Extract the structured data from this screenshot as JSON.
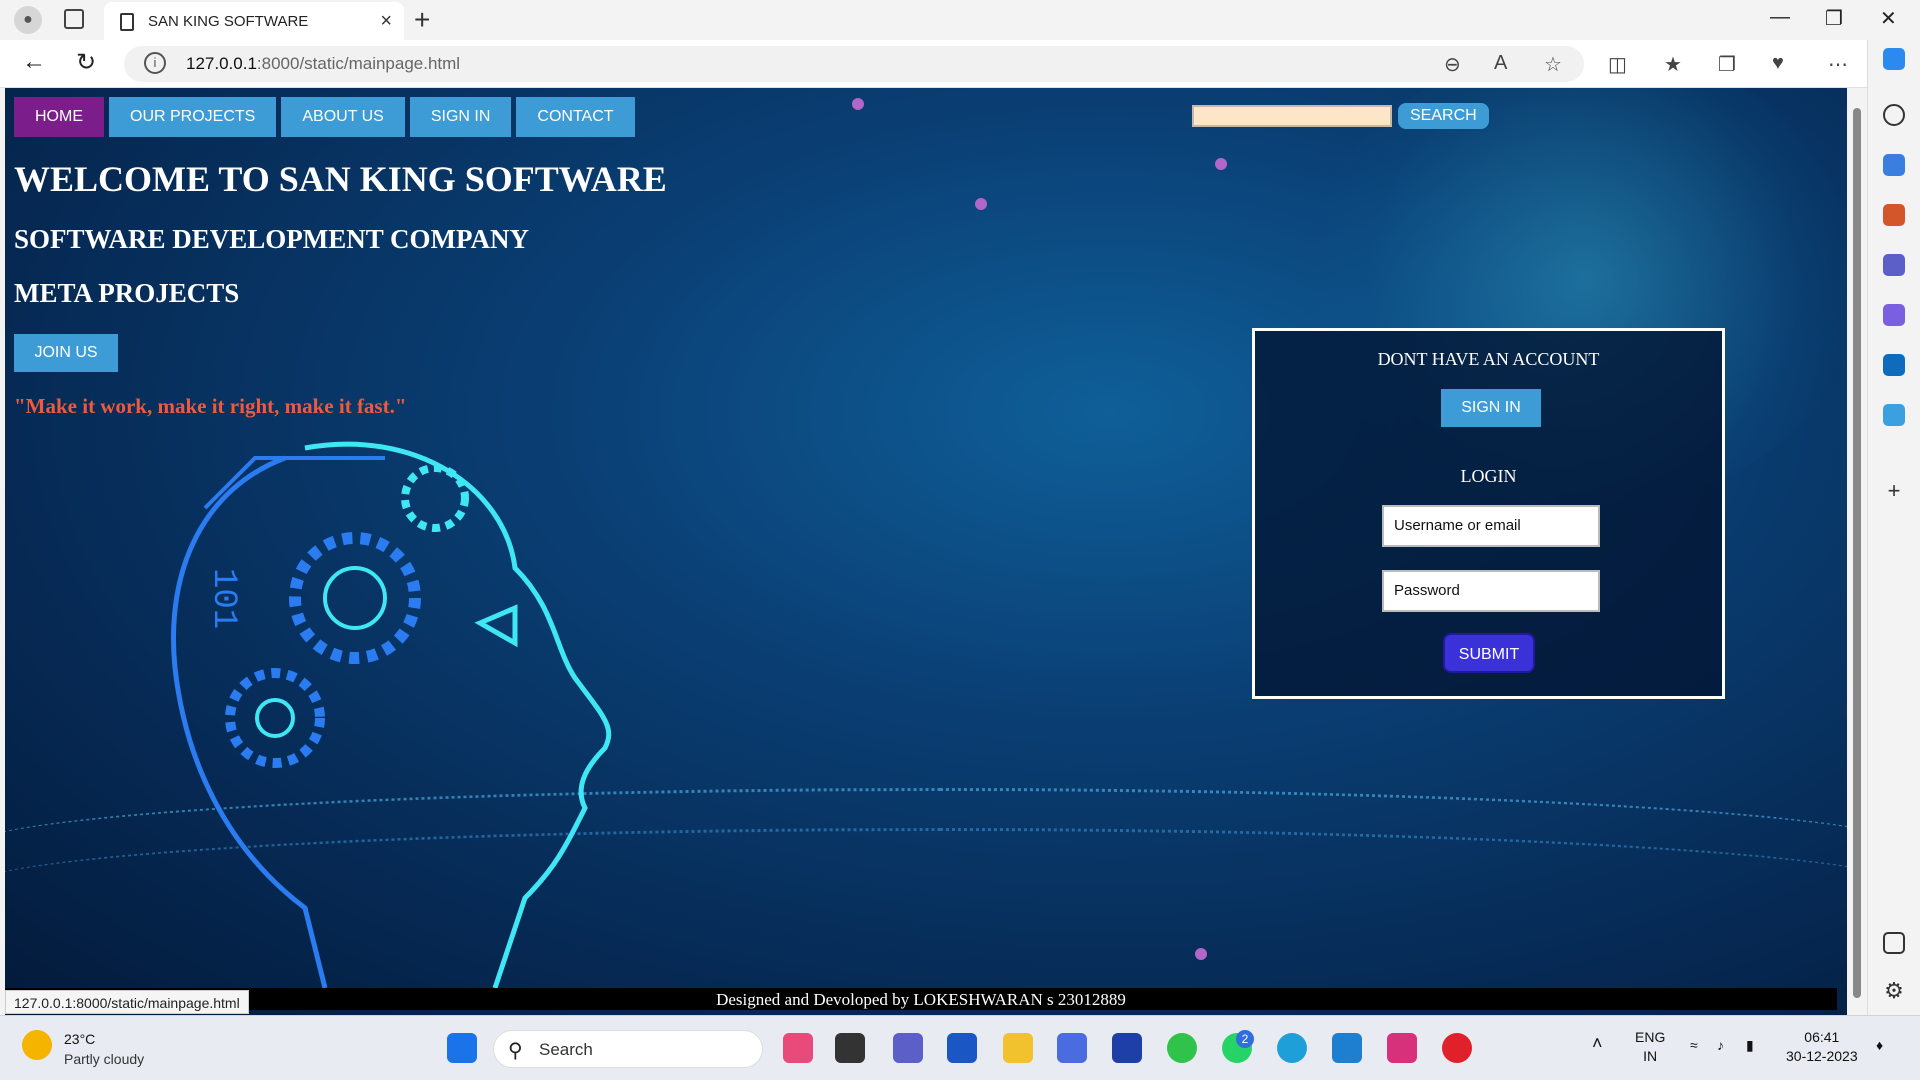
{
  "browser": {
    "tab_title": "SAN KING SOFTWARE",
    "url_host": "127.0.0.1",
    "url_path": ":8000/static/mainpage.html",
    "status_url": "127.0.0.1:8000/static/mainpage.html"
  },
  "site": {
    "nav": [
      {
        "label": "HOME",
        "active": true
      },
      {
        "label": "OUR PROJECTS",
        "active": false
      },
      {
        "label": "ABOUT US",
        "active": false
      },
      {
        "label": "SIGN IN",
        "active": false
      },
      {
        "label": "CONTACT",
        "active": false
      }
    ],
    "search_button": "SEARCH",
    "heading": "WELCOME TO SAN KING SOFTWARE",
    "subheading": "SOFTWARE DEVELOPMENT COMPANY",
    "subheading2": "META PROJECTS",
    "join_button": "JOIN US",
    "quote": "\"Make it work, make it right, make it fast.\"",
    "footer": "Designed and Devoloped by LOKESHWARAN s 23012889"
  },
  "login_panel": {
    "no_account_text": "DONT HAVE AN ACCOUNT",
    "signin_button": "SIGN IN",
    "login_heading": "LOGIN",
    "username_placeholder": "Username or email",
    "password_placeholder": "Password",
    "submit_button": "SUBMIT"
  },
  "taskbar": {
    "temperature": "23°C",
    "weather": "Partly cloudy",
    "search_label": "Search",
    "lang_top": "ENG",
    "lang_bottom": "IN",
    "time": "06:41",
    "date": "30-12-2023",
    "whatsapp_badge": "2"
  },
  "colors": {
    "nav_blue": "#3d9bd6",
    "nav_active": "#7b1e8c",
    "quote": "#ef5a3c",
    "submit": "#3a32d8"
  }
}
